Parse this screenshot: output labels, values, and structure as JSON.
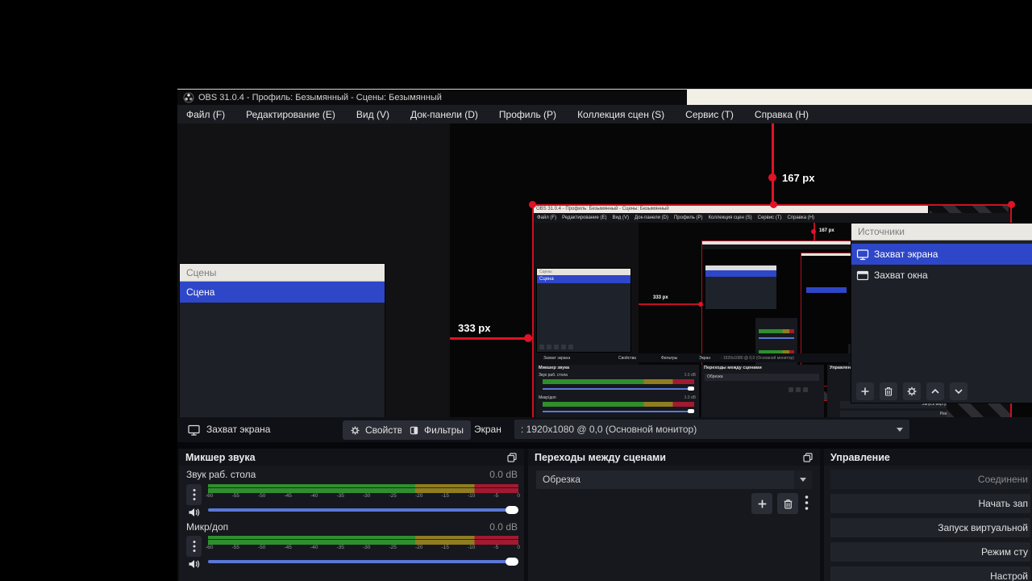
{
  "window": {
    "title": "OBS 31.0.4 - Профиль: Безымянный - Сцены: Безымянный"
  },
  "menu": {
    "items": [
      "Файл (F)",
      "Редактирование (E)",
      "Вид (V)",
      "Док-панели (D)",
      "Профиль (P)",
      "Коллекция сцен (S)",
      "Сервис (T)",
      "Справка (H)"
    ]
  },
  "preview": {
    "markers": {
      "top": "167 px",
      "left": "333 px"
    }
  },
  "scenes": {
    "header": "Сцены",
    "items": [
      {
        "label": "Сцена"
      }
    ]
  },
  "sources": {
    "header": "Источники",
    "items": [
      {
        "label": "Захват экрана"
      },
      {
        "label": "Захват окна"
      }
    ]
  },
  "source_toolbar": {
    "selected_source": "Захват экрана",
    "properties": "Свойства",
    "filters": "Фильтры",
    "screen_label": "Экран",
    "screen_value": ": 1920x1080 @ 0,0 (Основной монитор)"
  },
  "mixer": {
    "header": "Микшер звука",
    "ticks": [
      "-60",
      "-55",
      "-50",
      "-45",
      "-40",
      "-35",
      "-30",
      "-25",
      "-20",
      "-15",
      "-10",
      "-5",
      "0"
    ],
    "channels": [
      {
        "name": "Звук раб. стола",
        "value": "0.0 dB"
      },
      {
        "name": "Микр/доп",
        "value": "0.0 dB"
      }
    ],
    "meter": {
      "min_db": -60,
      "max_db": 0,
      "green_until_db": -20,
      "yellow_until_db": -8.5
    }
  },
  "transitions": {
    "header": "Переходы между сценами",
    "current": "Обрезка"
  },
  "controls": {
    "header": "Управление",
    "buttons": [
      {
        "label": "Соединени",
        "dimmed": true
      },
      {
        "label": "Начать зап",
        "dimmed": false
      },
      {
        "label": "Запуск виртуальной",
        "dimmed": false
      },
      {
        "label": "Режим сту",
        "dimmed": false
      },
      {
        "label": "Настрой",
        "dimmed": false
      }
    ]
  },
  "colors": {
    "selection_blue": "#2e46c8",
    "helper_red": "#e01226",
    "meter_green": "#2f8f2f",
    "meter_yellow": "#8f7d20",
    "meter_red": "#a21a31",
    "slider_blue": "#5b77d6",
    "dock_header_light": "#eae8e3",
    "titlebar_light": "#f2efe7"
  }
}
